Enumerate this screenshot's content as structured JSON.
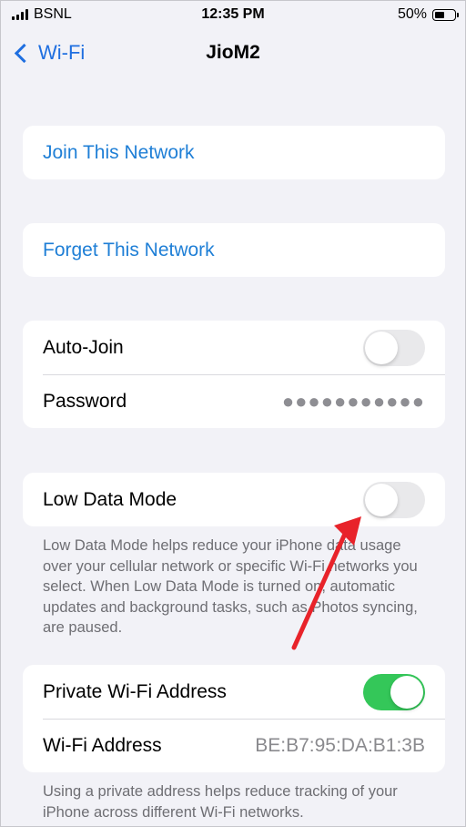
{
  "status_bar": {
    "carrier": "BSNL",
    "time": "12:35 PM",
    "battery_percent": "50%",
    "battery_level": 0.5
  },
  "nav": {
    "back_label": "Wi-Fi",
    "title": "JioM2"
  },
  "actions": {
    "join_label": "Join This Network",
    "forget_label": "Forget This Network"
  },
  "settings": {
    "auto_join_label": "Auto-Join",
    "auto_join_on": false,
    "password_label": "Password",
    "password_mask": "●●●●●●●●●●●",
    "low_data_label": "Low Data Mode",
    "low_data_on": false,
    "low_data_note": "Low Data Mode helps reduce your iPhone data usage over your cellular network or specific Wi-Fi networks you select. When Low Data Mode is turned on, automatic updates and background tasks, such as Photos syncing, are paused.",
    "private_address_label": "Private Wi-Fi Address",
    "private_address_on": true,
    "wifi_address_label": "Wi-Fi Address",
    "wifi_address_value": "BE:B7:95:DA:B1:3B",
    "private_note": "Using a private address helps reduce tracking of your iPhone across different Wi-Fi networks."
  },
  "colors": {
    "accent": "#1f7fd6",
    "toggle_on": "#34c759",
    "annotation_arrow": "#e8232a"
  },
  "icons": {
    "signal": "cellular-signal-icon",
    "battery": "battery-icon",
    "back": "chevron-left-icon"
  }
}
